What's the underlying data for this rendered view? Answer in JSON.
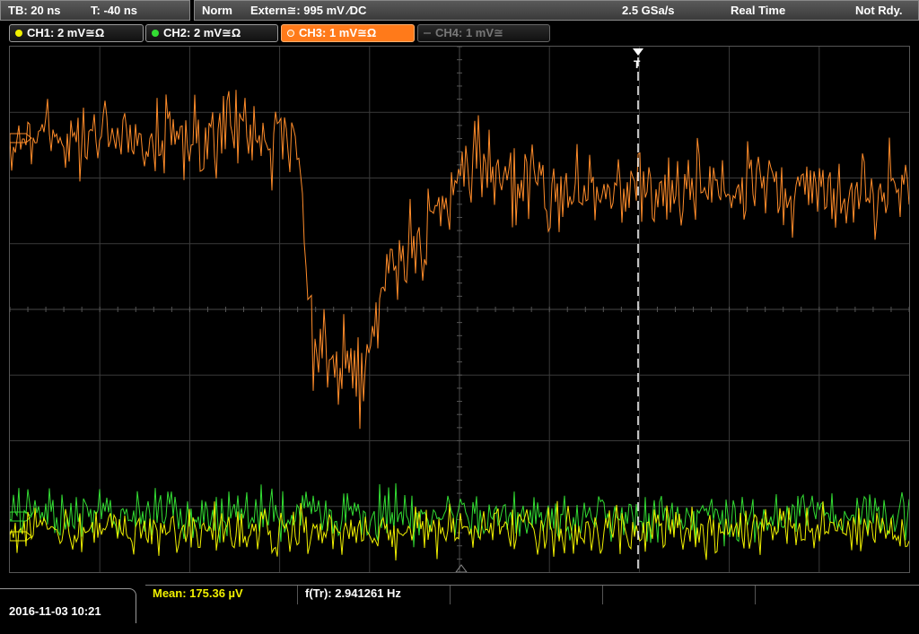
{
  "topbar": {
    "timebase": "TB: 20 ns",
    "trigger_time": "T: -40 ns",
    "trigger_mode": "Norm",
    "trigger_source": "Extern≅: 995 mV ∕DC",
    "sample_rate": "2.5 GSa/s",
    "acq_mode": "Real Time",
    "status": "Not Rdy."
  },
  "channels": [
    {
      "label": "CH1: 2 mV≅Ω",
      "color": "#f0f000"
    },
    {
      "label": "CH2: 2 mV≅Ω",
      "color": "#33dd33"
    },
    {
      "label": "CH3: 1 mV≅Ω",
      "color": "#ff8c2a"
    },
    {
      "label": "CH4: 1 mV≅",
      "color": "#555555"
    }
  ],
  "trigger_marker": "T",
  "bottom": {
    "datetime": "2016-11-03 10:21",
    "mean": "Mean: 175.36 µV",
    "freq": "f(Tr): 2.941261 Hz"
  },
  "colors": {
    "ch1": "#f0f000",
    "ch2": "#33dd33",
    "ch3": "#ff8c2a",
    "grid": "#3a3a3a"
  }
}
